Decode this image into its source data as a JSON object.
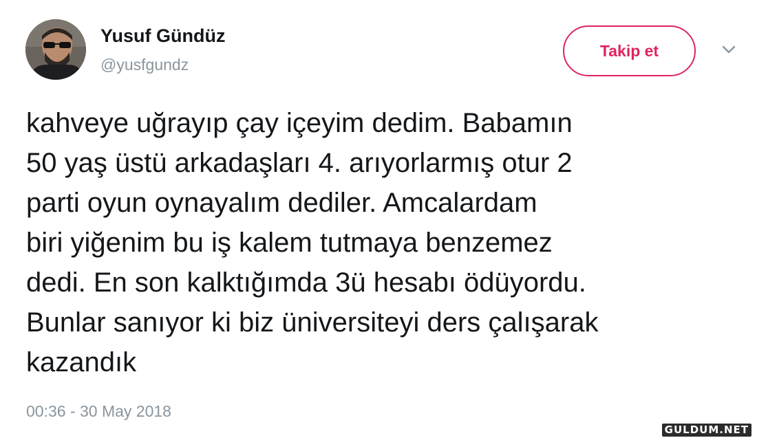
{
  "user": {
    "display_name": "Yusuf Gündüz",
    "handle": "@yusfgundz"
  },
  "follow_button": {
    "label": "Takip et"
  },
  "menu": {
    "icon": "chevron-down-icon"
  },
  "tweet": {
    "lines": [
      "kahveye uğrayıp çay içeyim dedim. Babamın",
      "50 yaş üstü arkadaşları 4. arıyorlarmış otur 2",
      "parti oyun oynayalım dediler. Amcalardam",
      "biri yiğenim bu iş kalem tutmaya benzemez",
      "dedi. En son kalktığımda 3ü hesabı ödüyordu.",
      "Bunlar sanıyor ki biz üniversiteyi ders çalışarak",
      "kazandık"
    ],
    "timestamp": "00:36 - 30 May 2018"
  },
  "watermark": {
    "text": "GULDUM.NET"
  },
  "colors": {
    "follow_accent": "#e0245e",
    "secondary_text": "#8a959e",
    "primary_text": "#14171a"
  }
}
